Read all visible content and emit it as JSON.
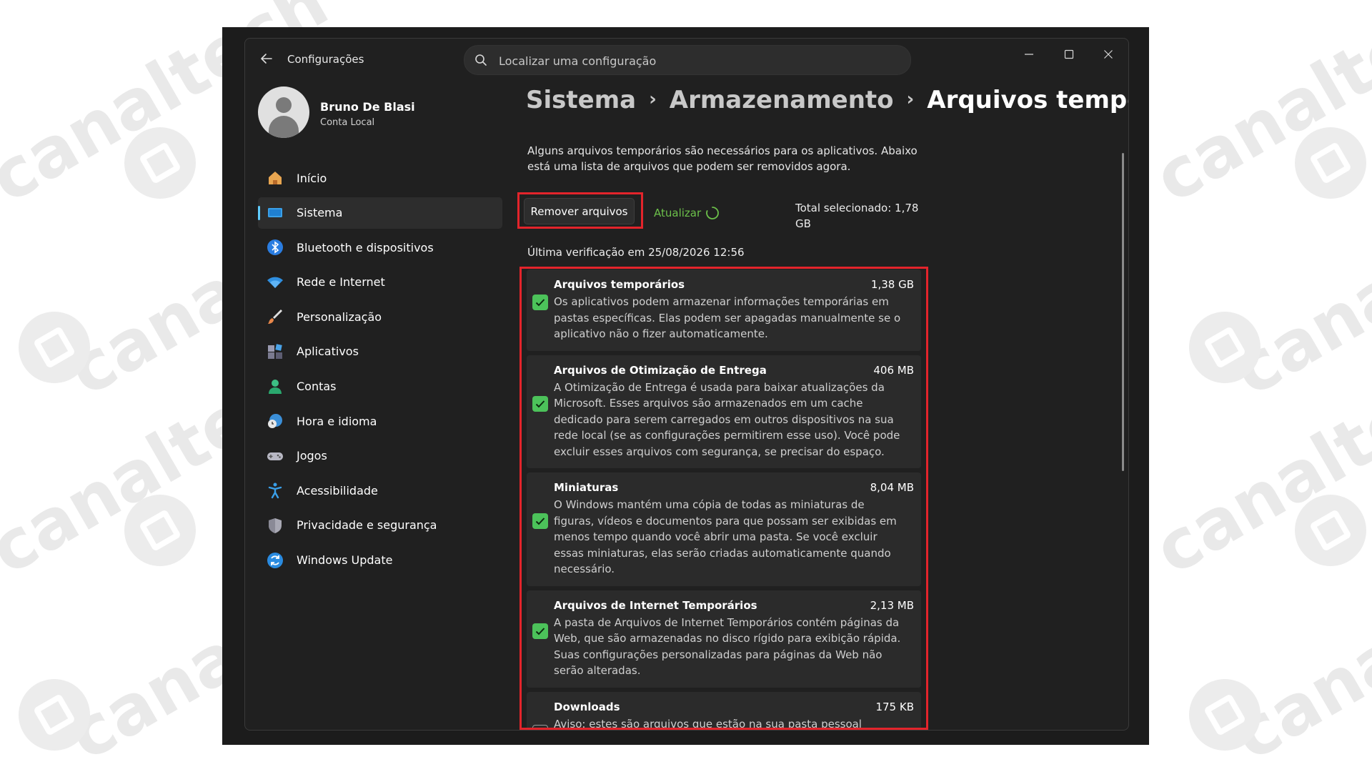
{
  "watermark": {
    "text": "canaltech"
  },
  "window": {
    "title": "Configurações",
    "search_placeholder": "Localizar uma configuração"
  },
  "profile": {
    "name": "Bruno De Blasi",
    "account_type": "Conta Local"
  },
  "sidebar": {
    "items": [
      {
        "label": "Início",
        "icon": "home-icon"
      },
      {
        "label": "Sistema",
        "icon": "system-icon",
        "active": true
      },
      {
        "label": "Bluetooth e dispositivos",
        "icon": "bluetooth-icon"
      },
      {
        "label": "Rede e Internet",
        "icon": "wifi-icon"
      },
      {
        "label": "Personalização",
        "icon": "brush-icon"
      },
      {
        "label": "Aplicativos",
        "icon": "apps-icon"
      },
      {
        "label": "Contas",
        "icon": "person-icon"
      },
      {
        "label": "Hora e idioma",
        "icon": "clock-globe-icon"
      },
      {
        "label": "Jogos",
        "icon": "gamepad-icon"
      },
      {
        "label": "Acessibilidade",
        "icon": "accessibility-icon"
      },
      {
        "label": "Privacidade e segurança",
        "icon": "shield-icon"
      },
      {
        "label": "Windows Update",
        "icon": "update-icon"
      }
    ]
  },
  "breadcrumb": {
    "items": [
      "Sistema",
      "Armazenamento"
    ],
    "current": "Arquivos temporários",
    "separator": "›"
  },
  "main": {
    "description": "Alguns arquivos temporários são necessários para os aplicativos. Abaixo está uma lista de arquivos que podem ser removidos agora.",
    "remove_button": "Remover arquivos",
    "refresh_label": "Atualizar",
    "total_selected": "Total selecionado: 1,78 GB",
    "last_check": "Última verificação em 25/08/2026 12:56",
    "items": [
      {
        "title": "Arquivos temporários",
        "size": "1,38 GB",
        "checked": true,
        "description": "Os aplicativos podem armazenar informações temporárias em pastas específicas. Elas podem ser apagadas manualmente se o aplicativo não o fizer automaticamente."
      },
      {
        "title": "Arquivos de Otimização de Entrega",
        "size": "406 MB",
        "checked": true,
        "description": "A Otimização de Entrega é usada para baixar atualizações da Microsoft. Esses arquivos são armazenados em um cache dedicado para serem carregados em outros dispositivos na sua rede local (se as configurações permitirem esse uso). Você pode excluir esses arquivos com segurança, se precisar do espaço."
      },
      {
        "title": "Miniaturas",
        "size": "8,04 MB",
        "checked": true,
        "description": "O Windows mantém uma cópia de todas as miniaturas de figuras, vídeos e documentos para que possam ser exibidas em menos tempo quando você abrir uma pasta. Se você excluir essas miniaturas, elas serão criadas automaticamente quando necessário."
      },
      {
        "title": "Arquivos de Internet Temporários",
        "size": "2,13 MB",
        "checked": true,
        "description": "A pasta de Arquivos de Internet Temporários contém páginas da Web, que são armazenadas no disco rígido para exibição rápida. Suas configurações personalizadas para páginas da Web não serão alteradas."
      },
      {
        "title": "Downloads",
        "size": "175 KB",
        "checked": false,
        "description": "Aviso: estes são arquivos que estão na sua pasta pessoal Downloads. Selecione esta opção se desejar excluir tudo. Isso não respeita as configurações do Sensor de Armazenamento."
      }
    ]
  },
  "colors": {
    "accent": "#60cdff",
    "highlight": "#e3242b",
    "check": "#4cc25a",
    "refresh": "#6cc04a"
  }
}
